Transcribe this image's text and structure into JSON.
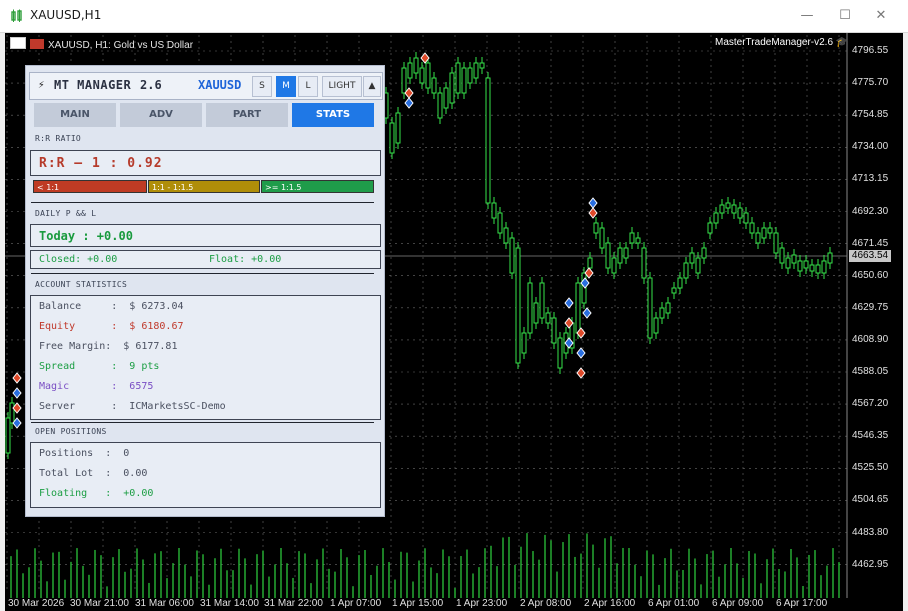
{
  "window": {
    "title": "XAUUSD,H1",
    "minimize": "—",
    "maximize": "☐",
    "close": "✕"
  },
  "chart": {
    "header": "XAUUSD, H1:  Gold vs US Dollar",
    "brand": "MasterTradeManager-v2.6",
    "current_price": "4663.54",
    "price_labels": [
      "4796.55",
      "4775.70",
      "4754.85",
      "4734.00",
      "4713.15",
      "4692.30",
      "4671.45",
      "4650.60",
      "4629.75",
      "4608.90",
      "4588.05",
      "4567.20",
      "4546.35",
      "4525.50",
      "4504.65",
      "4483.80",
      "4462.95"
    ],
    "time_labels": [
      "30 Mar 2026",
      "30 Mar 21:00",
      "31 Mar 06:00",
      "31 Mar 14:00",
      "31 Mar 22:00",
      "1 Apr 07:00",
      "1 Apr 15:00",
      "1 Apr 23:00",
      "2 Apr 08:00",
      "2 Apr 16:00",
      "6 Apr 01:00",
      "6 Apr 09:00",
      "6 Apr 17:00"
    ],
    "colors": {
      "bull": "#36e34a",
      "bear": "#36e34a",
      "bg": "#000000",
      "grid": "#6b6b6b",
      "volume": "#2fd43f"
    }
  },
  "panel": {
    "title": "MT MANAGER",
    "version": "2.6",
    "symbol": "XAUUSD",
    "mini_buttons": [
      "S",
      "M",
      "L",
      "LIGHT",
      "▲"
    ],
    "tabs": [
      "MAIN",
      "ADV",
      "PART",
      "STATS"
    ],
    "rr": {
      "section": "R:R RATIO",
      "value": "R:R  —  1 : 0.92",
      "bars": [
        {
          "label": "< 1:1",
          "color": "#bf3b24"
        },
        {
          "label": "1:1 - 1:1.5",
          "color": "#b08e09"
        },
        {
          "label": ">= 1:1.5",
          "color": "#1f9c4a"
        }
      ]
    },
    "daily": {
      "section": "DAILY  P && L",
      "today": "Today :  +0.00",
      "closed": "Closed: +0.00",
      "float": "Float: +0.00"
    },
    "account": {
      "section": "ACCOUNT STATISTICS",
      "rows": [
        {
          "text": "Balance     :  $ 6273.04",
          "color": "#4a5060"
        },
        {
          "text": "Equity      :  $ 6180.67",
          "color": "#c0392b"
        },
        {
          "text": "Free Margin:  $ 6177.81",
          "color": "#4a5060"
        },
        {
          "text": "Spread      :  9 pts",
          "color": "#1c9e44"
        },
        {
          "text": "Magic       :  6575",
          "color": "#7a4fc4"
        },
        {
          "text": "Server      :  ICMarketsSC-Demo",
          "color": "#4a5060"
        }
      ]
    },
    "positions": {
      "section": "OPEN POSITIONS",
      "rows": [
        {
          "text": "Positions  :  0",
          "color": "#4a5060"
        },
        {
          "text": "Total Lot  :  0.00",
          "color": "#4a5060"
        },
        {
          "text": "Floating   :  +0.00",
          "color": "#1c9e44"
        }
      ]
    }
  }
}
